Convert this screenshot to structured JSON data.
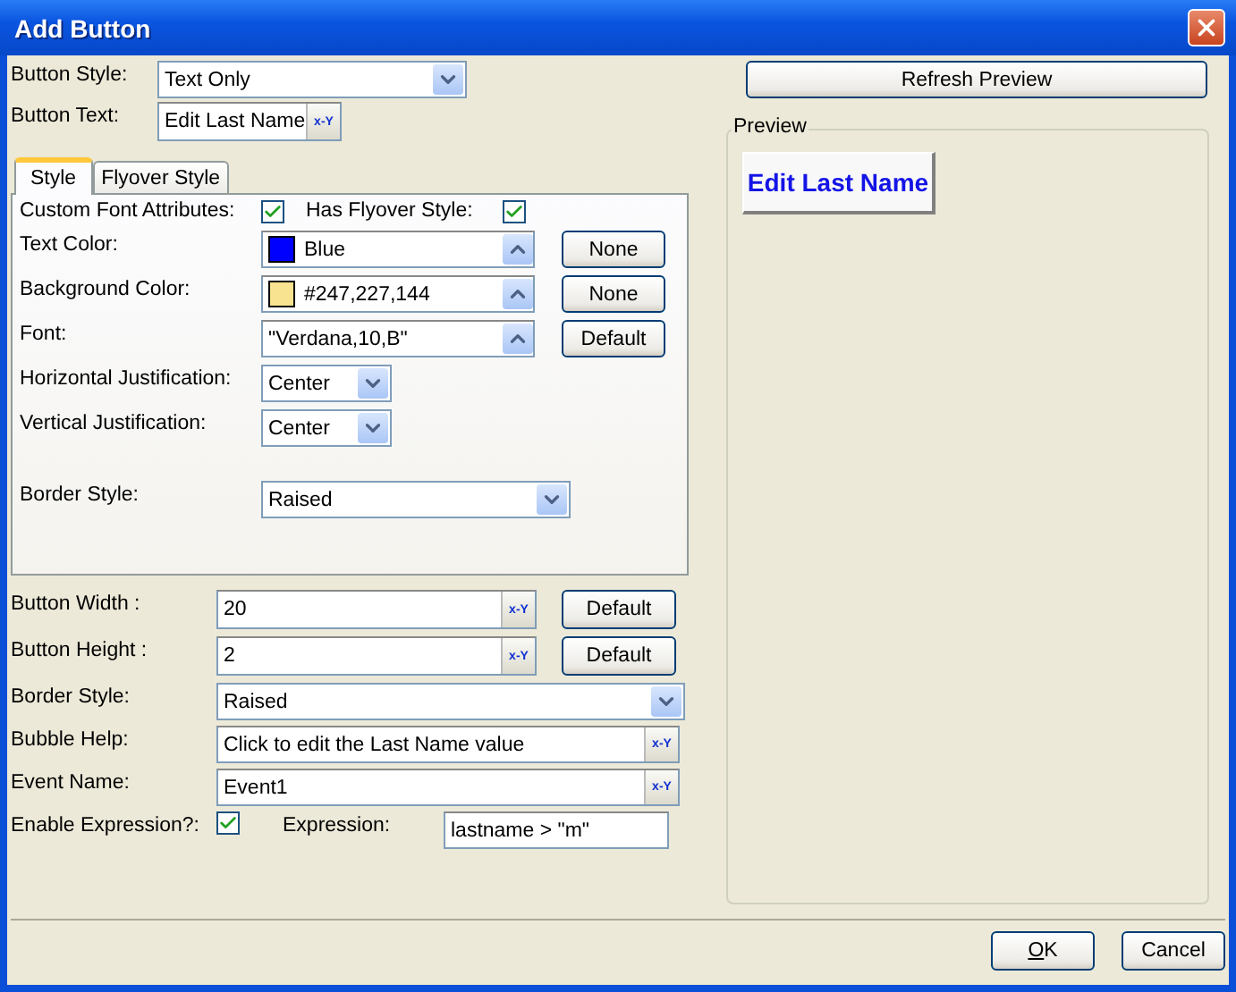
{
  "window": {
    "title": "Add Button"
  },
  "button_style": {
    "label": "Button Style:",
    "value": "Text Only"
  },
  "button_text": {
    "label": "Button Text:",
    "value": "Edit Last Name",
    "expr_button": "x-Y"
  },
  "refresh_button": "Refresh Preview",
  "preview": {
    "title": "Preview",
    "button_label": "Edit Last Name"
  },
  "tabs": [
    {
      "label": "Style",
      "selected": true
    },
    {
      "label": "Flyover Style",
      "selected": false
    }
  ],
  "style_panel": {
    "custom_font": {
      "label": "Custom Font Attributes:",
      "checked": true
    },
    "has_flyover": {
      "label": "Has Flyover Style:",
      "checked": true
    },
    "rows": [
      {
        "kind": "color",
        "label": "Text Color:",
        "value": "Blue",
        "color": "#0000ff",
        "button": "None"
      },
      {
        "kind": "color",
        "label": "Background Color:",
        "value": "#247,227,144",
        "color": "#f7e390",
        "button": "None"
      },
      {
        "kind": "font",
        "label": "Font:",
        "value": "\"Verdana,10,B\"",
        "button": "Default"
      },
      {
        "kind": "select",
        "label": "Horizontal Justification:",
        "value": "Center"
      },
      {
        "kind": "select",
        "label": "Vertical Justification:",
        "value": "Center"
      },
      {
        "kind": "wide_select",
        "label": "Border Style:",
        "value": "Raised"
      }
    ]
  },
  "fields": [
    {
      "kind": "expr",
      "label": "Button Width :",
      "value": "20",
      "expr_button": "x-Y",
      "button": "Default"
    },
    {
      "kind": "expr",
      "label": "Button Height :",
      "value": "2",
      "expr_button": "x-Y",
      "button": "Default"
    },
    {
      "kind": "select",
      "label": "Border Style:",
      "value": "Raised"
    },
    {
      "kind": "expr",
      "label": "Bubble Help:",
      "value": "Click to edit the Last Name value",
      "expr_button": "x-Y"
    },
    {
      "kind": "expr",
      "label": "Event Name:",
      "value": "Event1",
      "expr_button": "x-Y"
    }
  ],
  "enable_expression": {
    "label": "Enable Expression?:",
    "checked": true,
    "expression_label": "Expression:",
    "expression": "lastname > \"m\""
  },
  "buttons": [
    {
      "label": "OK"
    },
    {
      "label": "Cancel"
    }
  ]
}
